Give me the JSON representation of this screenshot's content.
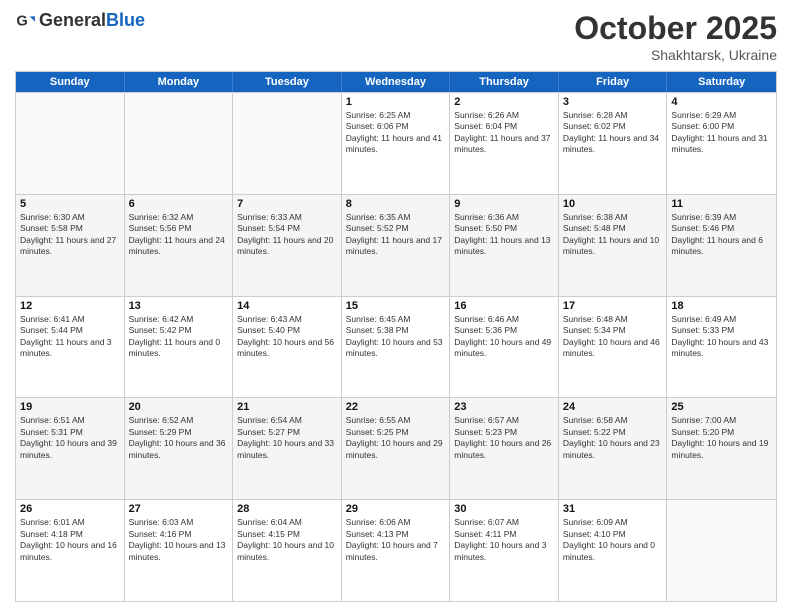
{
  "header": {
    "logo_general": "General",
    "logo_blue": "Blue",
    "month": "October 2025",
    "location": "Shakhtarsk, Ukraine"
  },
  "days_of_week": [
    "Sunday",
    "Monday",
    "Tuesday",
    "Wednesday",
    "Thursday",
    "Friday",
    "Saturday"
  ],
  "weeks": [
    [
      {
        "day": "",
        "text": ""
      },
      {
        "day": "",
        "text": ""
      },
      {
        "day": "",
        "text": ""
      },
      {
        "day": "1",
        "text": "Sunrise: 6:25 AM\nSunset: 6:06 PM\nDaylight: 11 hours and 41 minutes."
      },
      {
        "day": "2",
        "text": "Sunrise: 6:26 AM\nSunset: 6:04 PM\nDaylight: 11 hours and 37 minutes."
      },
      {
        "day": "3",
        "text": "Sunrise: 6:28 AM\nSunset: 6:02 PM\nDaylight: 11 hours and 34 minutes."
      },
      {
        "day": "4",
        "text": "Sunrise: 6:29 AM\nSunset: 6:00 PM\nDaylight: 11 hours and 31 minutes."
      }
    ],
    [
      {
        "day": "5",
        "text": "Sunrise: 6:30 AM\nSunset: 5:58 PM\nDaylight: 11 hours and 27 minutes."
      },
      {
        "day": "6",
        "text": "Sunrise: 6:32 AM\nSunset: 5:56 PM\nDaylight: 11 hours and 24 minutes."
      },
      {
        "day": "7",
        "text": "Sunrise: 6:33 AM\nSunset: 5:54 PM\nDaylight: 11 hours and 20 minutes."
      },
      {
        "day": "8",
        "text": "Sunrise: 6:35 AM\nSunset: 5:52 PM\nDaylight: 11 hours and 17 minutes."
      },
      {
        "day": "9",
        "text": "Sunrise: 6:36 AM\nSunset: 5:50 PM\nDaylight: 11 hours and 13 minutes."
      },
      {
        "day": "10",
        "text": "Sunrise: 6:38 AM\nSunset: 5:48 PM\nDaylight: 11 hours and 10 minutes."
      },
      {
        "day": "11",
        "text": "Sunrise: 6:39 AM\nSunset: 5:46 PM\nDaylight: 11 hours and 6 minutes."
      }
    ],
    [
      {
        "day": "12",
        "text": "Sunrise: 6:41 AM\nSunset: 5:44 PM\nDaylight: 11 hours and 3 minutes."
      },
      {
        "day": "13",
        "text": "Sunrise: 6:42 AM\nSunset: 5:42 PM\nDaylight: 11 hours and 0 minutes."
      },
      {
        "day": "14",
        "text": "Sunrise: 6:43 AM\nSunset: 5:40 PM\nDaylight: 10 hours and 56 minutes."
      },
      {
        "day": "15",
        "text": "Sunrise: 6:45 AM\nSunset: 5:38 PM\nDaylight: 10 hours and 53 minutes."
      },
      {
        "day": "16",
        "text": "Sunrise: 6:46 AM\nSunset: 5:36 PM\nDaylight: 10 hours and 49 minutes."
      },
      {
        "day": "17",
        "text": "Sunrise: 6:48 AM\nSunset: 5:34 PM\nDaylight: 10 hours and 46 minutes."
      },
      {
        "day": "18",
        "text": "Sunrise: 6:49 AM\nSunset: 5:33 PM\nDaylight: 10 hours and 43 minutes."
      }
    ],
    [
      {
        "day": "19",
        "text": "Sunrise: 6:51 AM\nSunset: 5:31 PM\nDaylight: 10 hours and 39 minutes."
      },
      {
        "day": "20",
        "text": "Sunrise: 6:52 AM\nSunset: 5:29 PM\nDaylight: 10 hours and 36 minutes."
      },
      {
        "day": "21",
        "text": "Sunrise: 6:54 AM\nSunset: 5:27 PM\nDaylight: 10 hours and 33 minutes."
      },
      {
        "day": "22",
        "text": "Sunrise: 6:55 AM\nSunset: 5:25 PM\nDaylight: 10 hours and 29 minutes."
      },
      {
        "day": "23",
        "text": "Sunrise: 6:57 AM\nSunset: 5:23 PM\nDaylight: 10 hours and 26 minutes."
      },
      {
        "day": "24",
        "text": "Sunrise: 6:58 AM\nSunset: 5:22 PM\nDaylight: 10 hours and 23 minutes."
      },
      {
        "day": "25",
        "text": "Sunrise: 7:00 AM\nSunset: 5:20 PM\nDaylight: 10 hours and 19 minutes."
      }
    ],
    [
      {
        "day": "26",
        "text": "Sunrise: 6:01 AM\nSunset: 4:18 PM\nDaylight: 10 hours and 16 minutes."
      },
      {
        "day": "27",
        "text": "Sunrise: 6:03 AM\nSunset: 4:16 PM\nDaylight: 10 hours and 13 minutes."
      },
      {
        "day": "28",
        "text": "Sunrise: 6:04 AM\nSunset: 4:15 PM\nDaylight: 10 hours and 10 minutes."
      },
      {
        "day": "29",
        "text": "Sunrise: 6:06 AM\nSunset: 4:13 PM\nDaylight: 10 hours and 7 minutes."
      },
      {
        "day": "30",
        "text": "Sunrise: 6:07 AM\nSunset: 4:11 PM\nDaylight: 10 hours and 3 minutes."
      },
      {
        "day": "31",
        "text": "Sunrise: 6:09 AM\nSunset: 4:10 PM\nDaylight: 10 hours and 0 minutes."
      },
      {
        "day": "",
        "text": ""
      }
    ]
  ]
}
